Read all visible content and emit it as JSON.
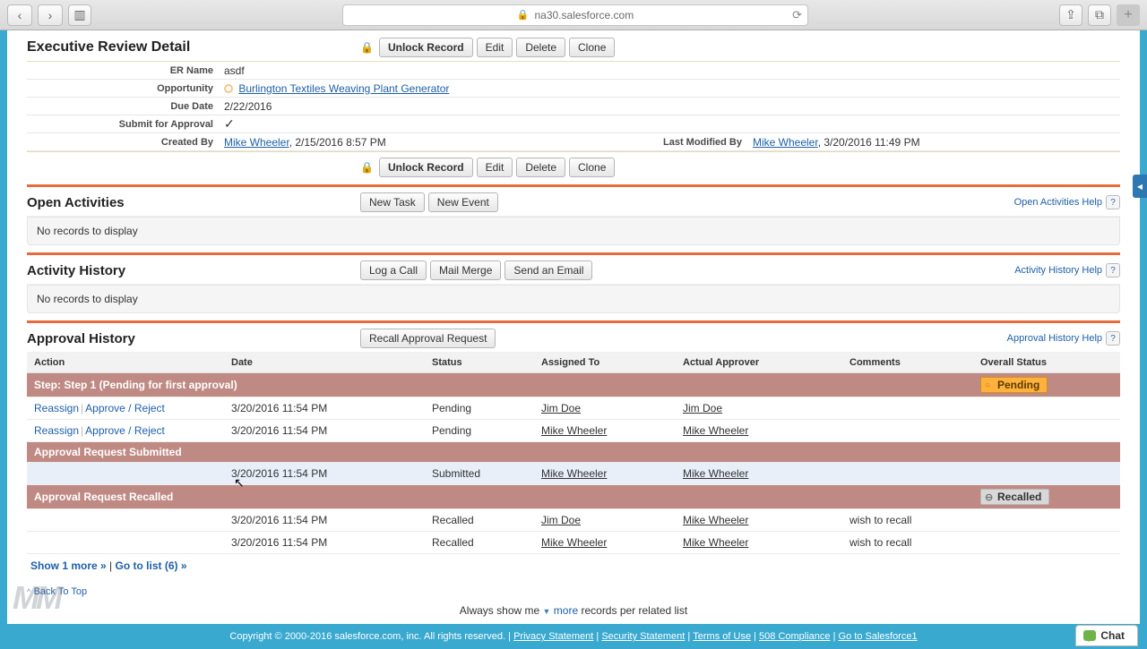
{
  "browser": {
    "url": "na30.salesforce.com"
  },
  "detail": {
    "title": "Executive Review Detail",
    "buttons": {
      "unlock": "Unlock Record",
      "edit": "Edit",
      "delete": "Delete",
      "clone": "Clone"
    },
    "fields": {
      "er_name_label": "ER Name",
      "er_name": "asdf",
      "opportunity_label": "Opportunity",
      "opportunity": "Burlington Textiles Weaving Plant Generator",
      "due_date_label": "Due Date",
      "due_date": "2/22/2016",
      "submit_label": "Submit for Approval",
      "created_label": "Created By",
      "created_user": "Mike Wheeler",
      "created_ts": ", 2/15/2016 8:57 PM",
      "modified_label": "Last Modified By",
      "modified_user": "Mike Wheeler",
      "modified_ts": ", 3/20/2016 11:49 PM"
    }
  },
  "open_activities": {
    "title": "Open Activities",
    "new_task": "New Task",
    "new_event": "New Event",
    "help": "Open Activities Help",
    "empty": "No records to display"
  },
  "activity_history": {
    "title": "Activity History",
    "log_call": "Log a Call",
    "mail_merge": "Mail Merge",
    "send_email": "Send an Email",
    "help": "Activity History Help",
    "empty": "No records to display"
  },
  "approval": {
    "title": "Approval History",
    "recall_btn": "Recall Approval Request",
    "help": "Approval History Help",
    "columns": {
      "action": "Action",
      "date": "Date",
      "status": "Status",
      "assigned": "Assigned To",
      "approver": "Actual Approver",
      "comments": "Comments",
      "overall": "Overall Status"
    },
    "step1_label": "Step: Step 1 (Pending for first approval)",
    "pending_label": "Pending",
    "rows_pending": [
      {
        "date": "3/20/2016 11:54 PM",
        "status": "Pending",
        "assigned": "Jim Doe",
        "approver": "Jim Doe"
      },
      {
        "date": "3/20/2016 11:54 PM",
        "status": "Pending",
        "assigned": "Mike Wheeler",
        "approver": "Mike Wheeler"
      }
    ],
    "submitted_label": "Approval Request Submitted",
    "row_submitted": {
      "date": "3/20/2016 11:54 PM",
      "status": "Submitted",
      "assigned": "Mike Wheeler",
      "approver": "Mike Wheeler"
    },
    "recalled_label": "Approval Request Recalled",
    "recalled_status": "Recalled",
    "rows_recalled": [
      {
        "date": "3/20/2016 11:54 PM",
        "status": "Recalled",
        "assigned": "Jim Doe",
        "approver": "Mike Wheeler",
        "comments": "wish to recall"
      },
      {
        "date": "3/20/2016 11:54 PM",
        "status": "Recalled",
        "assigned": "Mike Wheeler",
        "approver": "Mike Wheeler",
        "comments": "wish to recall"
      }
    ],
    "reassign": "Reassign",
    "approve_reject": "Approve / Reject",
    "show_more": "Show 1 more »",
    "goto_list": "Go to list (6) »"
  },
  "back_top": "Back To Top",
  "always_show": {
    "prefix": "Always show me",
    "more": "more",
    "suffix": "records per related list"
  },
  "footer": {
    "copyright": "Copyright © 2000-2016 salesforce.com, inc. All rights reserved.",
    "privacy": "Privacy Statement",
    "security": "Security Statement",
    "terms": "Terms of Use",
    "s508": "508 Compliance",
    "sf1": "Go to Salesforce1",
    "chat": "Chat"
  }
}
